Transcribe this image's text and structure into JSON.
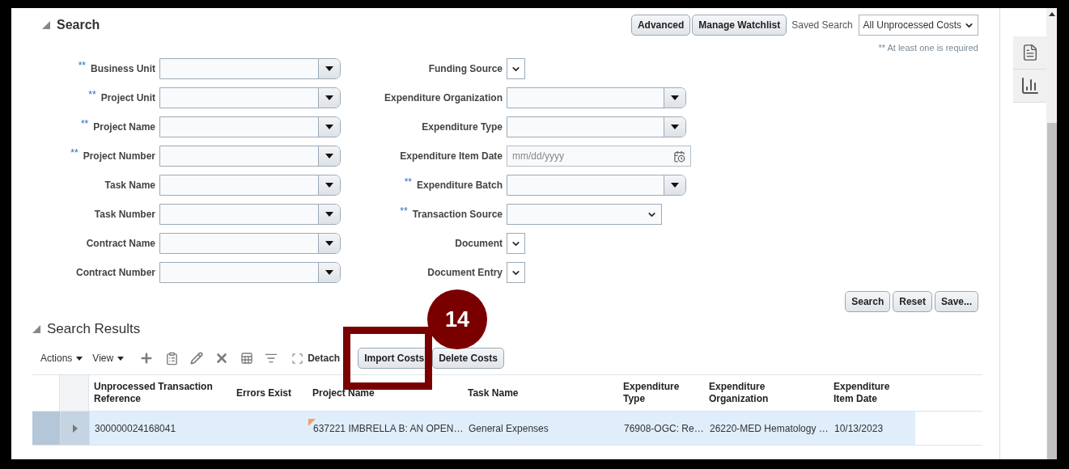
{
  "search_panel": {
    "title": "Search",
    "expanded": true,
    "buttons": [
      {
        "label": "Advanced"
      },
      {
        "label": "Manage Watchlist"
      }
    ],
    "saved_search_label": "Saved Search",
    "saved_search": "All Unprocessed Costs",
    "required_note": "** At least one is required",
    "left_fields": [
      {
        "label": "Business Unit",
        "mark": "**",
        "kind": "combo"
      },
      {
        "label": "Project Unit",
        "mark": "**",
        "kind": "combo"
      },
      {
        "label": "Project Name",
        "mark": "**",
        "kind": "combo"
      },
      {
        "label": "Project Number",
        "mark": "**",
        "kind": "combo"
      },
      {
        "label": "Task Name",
        "kind": "combo"
      },
      {
        "label": "Task Number",
        "kind": "combo"
      },
      {
        "label": "Contract Name",
        "kind": "combo"
      },
      {
        "label": "Contract Number",
        "kind": "combo"
      }
    ],
    "right_fields": [
      {
        "label": "Funding Source",
        "kind": "choice"
      },
      {
        "label": "Expenditure Organization",
        "kind": "combo"
      },
      {
        "label": "Expenditure Type",
        "kind": "combo"
      },
      {
        "label": "Expenditure Item Date",
        "kind": "date",
        "placeholder": "mm/dd/yyyy"
      },
      {
        "label": "Expenditure Batch",
        "mark": "**",
        "kind": "combo"
      },
      {
        "label": "Transaction Source",
        "mark": "**",
        "kind": "select"
      },
      {
        "label": "Document",
        "kind": "choice"
      },
      {
        "label": "Document Entry",
        "kind": "choice"
      }
    ],
    "actions": [
      {
        "label": "Search"
      },
      {
        "label": "Reset"
      },
      {
        "label": "Save..."
      }
    ]
  },
  "results": {
    "title": "Search Results",
    "expanded": true,
    "menus": [
      {
        "label": "Actions"
      },
      {
        "label": "View"
      }
    ],
    "detach": "Detach",
    "buttons": [
      {
        "label": "Import Costs"
      },
      {
        "label": "Delete Costs"
      }
    ],
    "columns": [
      "Unprocessed Transaction Reference",
      "Errors Exist",
      "Project Name",
      "Task Name",
      "Expenditure Type",
      "Expenditure Organization",
      "Expenditure Item Date"
    ],
    "rows": [
      {
        "selected": true,
        "expanded": false,
        "cells": [
          {
            "text": "300000024168041",
            "flagged": false
          },
          {},
          {
            "text": "637221 IMBRELLA B: AN OPEN…",
            "flagged": true
          },
          {
            "text": "General Expenses",
            "flagged": false
          },
          {
            "text": "76908-OGC: Re…",
            "flagged": false
          },
          {
            "text": "26220-MED Hematology …",
            "flagged": false
          },
          {
            "text": "10/13/2023",
            "flagged": false
          }
        ]
      }
    ]
  },
  "callout": {
    "number": "14"
  }
}
